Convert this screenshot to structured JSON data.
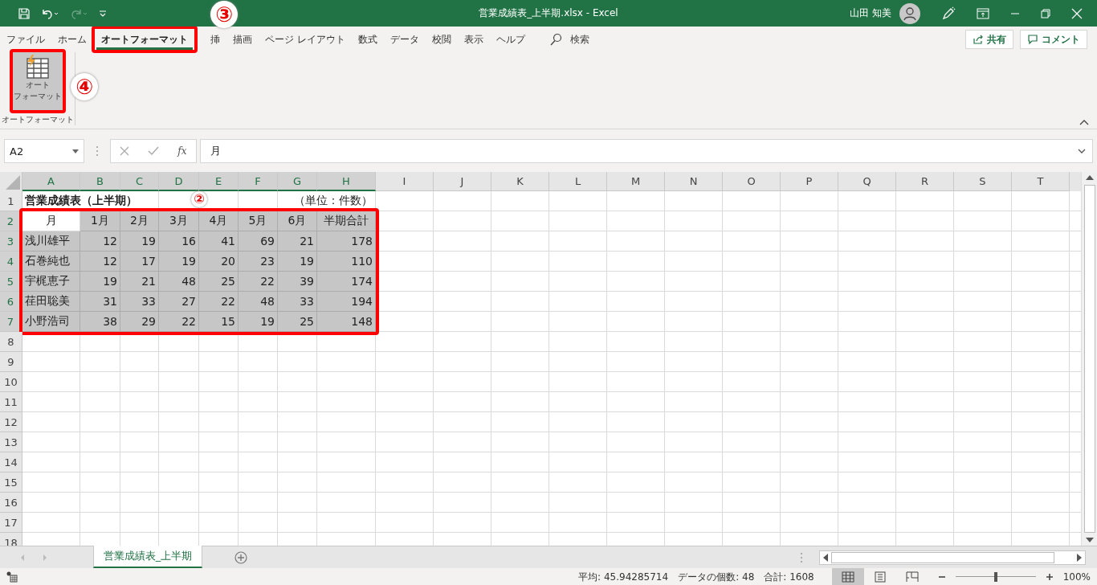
{
  "title_bar": {
    "title": "営業成績表_上半期.xlsx  -  Excel",
    "user": "山田 知美"
  },
  "ribbon_tabs": [
    {
      "label": "ファイル",
      "selected": false,
      "highlighted": false
    },
    {
      "label": "ホーム",
      "selected": false,
      "highlighted": false
    },
    {
      "label": "オートフォーマット",
      "selected": true,
      "highlighted": true
    },
    {
      "label": "挿",
      "selected": false,
      "highlighted": false
    },
    {
      "label": "描画",
      "selected": false,
      "highlighted": false
    },
    {
      "label": "ページ レイアウト",
      "selected": false,
      "highlighted": false
    },
    {
      "label": "数式",
      "selected": false,
      "highlighted": false
    },
    {
      "label": "データ",
      "selected": false,
      "highlighted": false
    },
    {
      "label": "校閲",
      "selected": false,
      "highlighted": false
    },
    {
      "label": "表示",
      "selected": false,
      "highlighted": false
    },
    {
      "label": "ヘルプ",
      "selected": false,
      "highlighted": false
    }
  ],
  "search": {
    "label": "検索"
  },
  "share_button": "共有",
  "comment_button": "コメント",
  "ribbon_group": {
    "button": {
      "line_1": "オート",
      "line_2": "フォーマット",
      "pressed": true,
      "highlighted": true
    },
    "label": "オートフォーマット"
  },
  "formula_bar": {
    "name_box": "A2",
    "fx": "fx",
    "formula": "月"
  },
  "sheet": {
    "range_frame": true,
    "columns": [
      {
        "label": "A",
        "selected": true
      },
      {
        "label": "B",
        "selected": true
      },
      {
        "label": "C",
        "selected": true
      },
      {
        "label": "D",
        "selected": true
      },
      {
        "label": "E",
        "selected": true
      },
      {
        "label": "F",
        "selected": true
      },
      {
        "label": "G",
        "selected": true
      },
      {
        "label": "H",
        "selected": true
      },
      {
        "label": "I",
        "selected": false
      },
      {
        "label": "J",
        "selected": false
      },
      {
        "label": "K",
        "selected": false
      },
      {
        "label": "L",
        "selected": false
      },
      {
        "label": "M",
        "selected": false
      },
      {
        "label": "N",
        "selected": false
      },
      {
        "label": "O",
        "selected": false
      },
      {
        "label": "P",
        "selected": false
      },
      {
        "label": "Q",
        "selected": false
      },
      {
        "label": "R",
        "selected": false
      },
      {
        "label": "S",
        "selected": false
      },
      {
        "label": "T",
        "selected": false
      }
    ],
    "rows": [
      {
        "header": "1",
        "kind": "title",
        "selected": false,
        "title": "営業成績表（上半期）",
        "unit": "（単位：件数）"
      },
      {
        "header": "2",
        "kind": "header",
        "selected": true,
        "cells": [
          {
            "text": "月",
            "selected": false
          },
          {
            "text": "1月",
            "selected": true
          },
          {
            "text": "2月",
            "selected": true
          },
          {
            "text": "3月",
            "selected": true
          },
          {
            "text": "4月",
            "selected": true
          },
          {
            "text": "5月",
            "selected": true
          },
          {
            "text": "6月",
            "selected": true
          },
          {
            "text": "半期合計",
            "selected": true
          }
        ]
      },
      {
        "header": "3",
        "kind": "data",
        "selected": true,
        "cells": [
          {
            "text": "浅川雄平",
            "selected": true
          },
          {
            "text": "12",
            "selected": true
          },
          {
            "text": "19",
            "selected": true
          },
          {
            "text": "16",
            "selected": true
          },
          {
            "text": "41",
            "selected": true
          },
          {
            "text": "69",
            "selected": true
          },
          {
            "text": "21",
            "selected": true
          },
          {
            "text": "178",
            "selected": true
          }
        ]
      },
      {
        "header": "4",
        "kind": "data",
        "selected": true,
        "cells": [
          {
            "text": "石巻純也",
            "selected": true
          },
          {
            "text": "12",
            "selected": true
          },
          {
            "text": "17",
            "selected": true
          },
          {
            "text": "19",
            "selected": true
          },
          {
            "text": "20",
            "selected": true
          },
          {
            "text": "23",
            "selected": true
          },
          {
            "text": "19",
            "selected": true
          },
          {
            "text": "110",
            "selected": true
          }
        ]
      },
      {
        "header": "5",
        "kind": "data",
        "selected": true,
        "cells": [
          {
            "text": "宇梶恵子",
            "selected": true
          },
          {
            "text": "19",
            "selected": true
          },
          {
            "text": "21",
            "selected": true
          },
          {
            "text": "48",
            "selected": true
          },
          {
            "text": "25",
            "selected": true
          },
          {
            "text": "22",
            "selected": true
          },
          {
            "text": "39",
            "selected": true
          },
          {
            "text": "174",
            "selected": true
          }
        ]
      },
      {
        "header": "6",
        "kind": "data",
        "selected": true,
        "cells": [
          {
            "text": "荏田聡美",
            "selected": true
          },
          {
            "text": "31",
            "selected": true
          },
          {
            "text": "33",
            "selected": true
          },
          {
            "text": "27",
            "selected": true
          },
          {
            "text": "22",
            "selected": true
          },
          {
            "text": "48",
            "selected": true
          },
          {
            "text": "33",
            "selected": true
          },
          {
            "text": "194",
            "selected": true
          }
        ]
      },
      {
        "header": "7",
        "kind": "data",
        "selected": true,
        "cells": [
          {
            "text": "小野浩司",
            "selected": true
          },
          {
            "text": "38",
            "selected": true
          },
          {
            "text": "29",
            "selected": true
          },
          {
            "text": "22",
            "selected": true
          },
          {
            "text": "15",
            "selected": true
          },
          {
            "text": "19",
            "selected": true
          },
          {
            "text": "25",
            "selected": true
          },
          {
            "text": "148",
            "selected": true
          }
        ]
      },
      {
        "header": "8",
        "kind": "data",
        "selected": false
      },
      {
        "header": "9",
        "kind": "data",
        "selected": false
      },
      {
        "header": "10",
        "kind": "data",
        "selected": false
      },
      {
        "header": "11",
        "kind": "data",
        "selected": false
      },
      {
        "header": "12",
        "kind": "data",
        "selected": false
      },
      {
        "header": "13",
        "kind": "data",
        "selected": false
      },
      {
        "header": "14",
        "kind": "data",
        "selected": false
      },
      {
        "header": "15",
        "kind": "data",
        "selected": false
      },
      {
        "header": "16",
        "kind": "data",
        "selected": false
      },
      {
        "header": "17",
        "kind": "data",
        "selected": false
      },
      {
        "header": "18",
        "kind": "data",
        "selected": false
      }
    ]
  },
  "sheet_tabs": [
    {
      "label": "営業成績表_上半期",
      "selected": true
    }
  ],
  "status_bar": {
    "average": "平均: 45.94285714",
    "count": "データの個数: 48",
    "sum": "合計: 1608",
    "views": [
      {
        "kind": "normal",
        "selected": true
      },
      {
        "kind": "page_layout",
        "selected": false
      },
      {
        "kind": "page_break",
        "selected": false
      }
    ],
    "zoom": {
      "level": 0.5,
      "reading": "100%"
    }
  },
  "annotations": [
    {
      "kind": "badge",
      "text": "③"
    },
    {
      "kind": "badge",
      "text": "④"
    },
    {
      "kind": "badge",
      "text": "②"
    }
  ]
}
